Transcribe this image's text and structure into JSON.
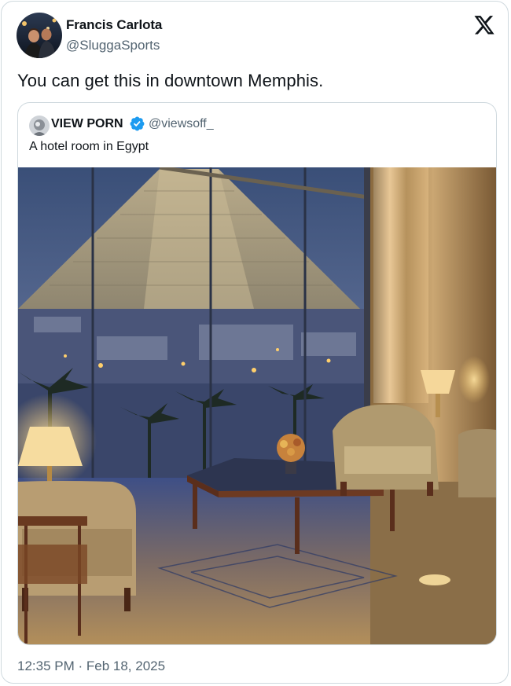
{
  "author": {
    "name": "Francis Carlota",
    "handle": "@SluggaSports"
  },
  "platform_icon": "x-logo-icon",
  "tweet": {
    "text": "You can get this in downtown Memphis."
  },
  "quoted": {
    "name": "VIEW PORN",
    "verified": true,
    "verified_icon": "verified-badge-icon",
    "verified_color": "#1d9bf0",
    "handle": "@viewsoff_",
    "text": "A hotel room in Egypt"
  },
  "timestamp": "12:35 PM · Feb 18, 2025",
  "colors": {
    "text": "#0f1419",
    "secondary": "#536471",
    "border": "#cfd9de"
  }
}
